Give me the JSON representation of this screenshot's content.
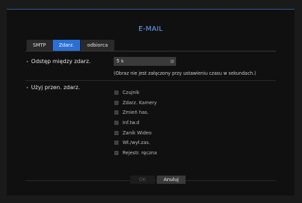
{
  "window": {
    "title": "E-MAIL"
  },
  "tabs": [
    {
      "label": "SMTP",
      "active": false
    },
    {
      "label": "Zdarz.",
      "active": true
    },
    {
      "label": "odbiorca",
      "active": false
    }
  ],
  "interval": {
    "label": "Odstęp między zdarz.",
    "value": "5 s",
    "hint": "(Obraz nie  jest załączony przy ustawieniu czasu w sekundach.)"
  },
  "events": {
    "label": "Użyj przen. zdarz.",
    "items": [
      {
        "label": "Czujnik",
        "checked": false
      },
      {
        "label": "Zdarz. Kamery",
        "checked": false
      },
      {
        "label": "Zmień has.",
        "checked": false
      },
      {
        "label": "Inf.tw.d",
        "checked": false
      },
      {
        "label": "Zanik Wideo",
        "checked": false
      },
      {
        "label": "Wł./wył.zas.",
        "checked": false
      },
      {
        "label": "Rejestr. ręczna",
        "checked": false
      }
    ]
  },
  "buttons": {
    "ok": "OK",
    "cancel": "Anuluj"
  },
  "colors": {
    "accent": "#2a6fd6",
    "title": "#6aa6ff",
    "background": "#101010"
  }
}
